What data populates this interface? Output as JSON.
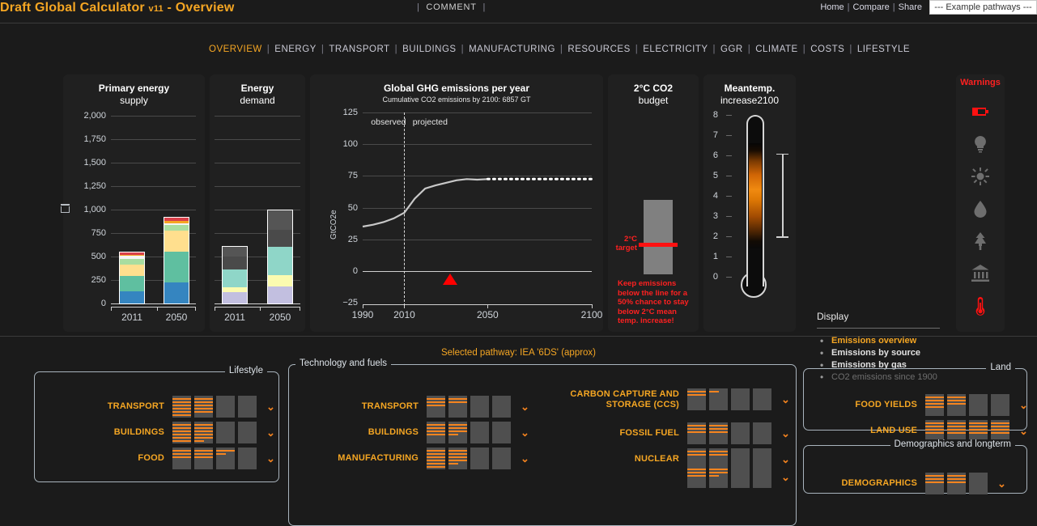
{
  "header": {
    "title": "Draft Global Calculator",
    "version": "v11",
    "title_suffix": "- Overview",
    "comment": "COMMENT",
    "sep": "|",
    "links": [
      {
        "label": "Home"
      },
      {
        "label": "Compare"
      },
      {
        "label": "Share"
      }
    ],
    "pathway_select": "--- Example pathways ---"
  },
  "nav": {
    "items": [
      {
        "label": "OVERVIEW",
        "active": true
      },
      {
        "label": "ENERGY",
        "active": false
      },
      {
        "label": "TRANSPORT",
        "active": false
      },
      {
        "label": "BUILDINGS",
        "active": false
      },
      {
        "label": "MANUFACTURING",
        "active": false
      },
      {
        "label": "RESOURCES",
        "active": false
      },
      {
        "label": "ELECTRICITY",
        "active": false
      },
      {
        "label": "GGR",
        "active": false
      },
      {
        "label": "CLIMATE",
        "active": false
      },
      {
        "label": "COSTS",
        "active": false
      },
      {
        "label": "LIFESTYLE",
        "active": false
      }
    ],
    "sep": "|"
  },
  "chart_data": [
    {
      "type": "bar",
      "id": "primary-energy-supply",
      "title": "Primary energy",
      "title2": "supply",
      "categories": [
        "2011",
        "2050"
      ],
      "ylim": [
        0,
        2000
      ],
      "yticks": [
        0,
        250,
        500,
        750,
        1000,
        1250,
        1500,
        1750,
        2000
      ],
      "ytick_labels": [
        "0",
        "250",
        "500",
        "750",
        "1,000",
        "1,250",
        "1,500",
        "1,750",
        "2,000"
      ],
      "unit_icon": "energy-unit-icon",
      "stacked": true,
      "series": [
        {
          "name": "blue",
          "color": "#3585c0",
          "values": [
            128,
            222
          ]
        },
        {
          "name": "green",
          "color": "#5fbfa0",
          "values": [
            168,
            327
          ]
        },
        {
          "name": "yellow",
          "color": "#ffdf8e",
          "values": [
            118,
            230
          ]
        },
        {
          "name": "lightgreen",
          "color": "#a9dda0",
          "values": [
            62,
            60
          ]
        },
        {
          "name": "white",
          "color": "#f4f4f4",
          "values": [
            32,
            12
          ]
        },
        {
          "name": "orange",
          "color": "#f5a623",
          "values": [
            10,
            26
          ]
        },
        {
          "name": "red",
          "color": "#d9404a",
          "values": [
            22,
            33
          ]
        }
      ],
      "totals": [
        540,
        910
      ]
    },
    {
      "type": "bar",
      "id": "energy-demand",
      "title": "Energy",
      "title2": "demand",
      "categories": [
        "2011",
        "2050"
      ],
      "ylim": [
        0,
        2000
      ],
      "stacked": true,
      "series": [
        {
          "name": "lavender",
          "color": "#c2bfe0",
          "values": [
            118,
            180
          ]
        },
        {
          "name": "paleyellow",
          "color": "#fbfbb0",
          "values": [
            57,
            118
          ]
        },
        {
          "name": "mint",
          "color": "#8fd6c8",
          "values": [
            183,
            305
          ]
        },
        {
          "name": "darkgray",
          "color": "#4a4a4a",
          "values": [
            145,
            185
          ]
        },
        {
          "name": "darkgray2",
          "color": "#555555",
          "values": [
            97,
            207
          ]
        }
      ],
      "totals": [
        600,
        995
      ]
    },
    {
      "type": "line",
      "id": "global-ghg-emissions",
      "title": "Global GHG emissions per year",
      "subtitle": "Cumulative CO2 emissions by 2100: 6857 GT",
      "ylabel": "GtCO2e",
      "xlim": [
        1990,
        2100
      ],
      "ylim": [
        -25,
        125
      ],
      "yticks": [
        -25,
        0,
        25,
        50,
        75,
        100,
        125
      ],
      "xticks": [
        1990,
        2010,
        2050,
        2100
      ],
      "divider_year": 2010,
      "region_labels": {
        "left": "observed",
        "right": "projected"
      },
      "line_color": "#c8c8c8",
      "marker_year": 2032,
      "marker_color": "#ff0000",
      "x": [
        1990,
        1995,
        2000,
        2005,
        2010,
        2015,
        2020,
        2025,
        2030,
        2035,
        2040,
        2045,
        2050,
        2060,
        2070,
        2080,
        2090,
        2100
      ],
      "y": [
        35,
        36.5,
        38.5,
        41.5,
        46,
        57,
        65,
        67.5,
        69.5,
        71.5,
        72.5,
        72,
        72.5,
        72.5,
        72.5,
        72.5,
        72.5,
        72.5
      ],
      "solid_until": 2050
    },
    {
      "type": "bar",
      "id": "co2-budget",
      "title": "2°C CO2",
      "title2": "budget",
      "target_label_line1": "2°C",
      "target_label_line2": "target",
      "note": "Keep emissions below the line for a 50% chance to stay below 2°C mean temp. increase!",
      "bar_color": "#808080",
      "line_color": "#ff1111",
      "bar_top_pct": 62,
      "target_pct": 53
    },
    {
      "type": "gauge",
      "id": "mean-temp-increase",
      "title": "Meantemp.",
      "title2": "increase2100",
      "ylim": [
        0,
        8
      ],
      "yticks": [
        0,
        1,
        2,
        3,
        4,
        5,
        6,
        7,
        8
      ],
      "fill_low": 1.4,
      "fill_high": 6.6,
      "range_low": 2.0,
      "range_high": 6.1
    }
  ],
  "display": {
    "title": "Display",
    "items": [
      {
        "label": "Emissions overview",
        "state": "selected"
      },
      {
        "label": "Emissions by source",
        "state": "normal"
      },
      {
        "label": "Emissions by gas",
        "state": "normal"
      },
      {
        "label": "CO2 emissions since 1900",
        "state": "disabled"
      }
    ]
  },
  "warnings": {
    "title": "Warnings",
    "icons": [
      {
        "name": "battery-icon",
        "color": "#ff1111"
      },
      {
        "name": "lightbulb-icon",
        "color": "#6e6e6e"
      },
      {
        "name": "sun-icon",
        "color": "#6e6e6e"
      },
      {
        "name": "droplet-icon",
        "color": "#6e6e6e"
      },
      {
        "name": "tree-icon",
        "color": "#6e6e6e"
      },
      {
        "name": "bank-icon",
        "color": "#6e6e6e"
      },
      {
        "name": "thermometer-icon",
        "color": "#ff1111"
      }
    ]
  },
  "selected_pathway": "Selected pathway: IEA '6DS' (approx)",
  "lever_groups": [
    {
      "legend": "Lifestyle",
      "rows": [
        {
          "label": "TRANSPORT",
          "boxes": [
            6,
            5,
            0,
            0
          ]
        },
        {
          "label": "BUILDINGS",
          "boxes": [
            6,
            5.5,
            0,
            0
          ]
        },
        {
          "label": "FOOD",
          "boxes": [
            3,
            3,
            1.5,
            0
          ]
        }
      ]
    },
    {
      "legend": "Technology and fuels",
      "rows": [
        {
          "label": "TRANSPORT",
          "boxes": [
            3,
            2,
            0,
            0
          ]
        },
        {
          "label": "BUILDINGS",
          "boxes": [
            4,
            3.5,
            0,
            0
          ]
        },
        {
          "label": "MANUFACTURING",
          "boxes": [
            6,
            4.5,
            0,
            0
          ]
        }
      ]
    },
    {
      "legend": "",
      "rows": [
        {
          "label": "CARBON CAPTURE AND STORAGE (CCS)",
          "boxes": [
            2,
            0.5,
            0,
            0
          ]
        },
        {
          "label": "FOSSIL FUEL",
          "boxes": [
            3,
            3,
            0,
            0
          ]
        },
        {
          "label": "NUCLEAR",
          "boxes": [
            2,
            2,
            0,
            0
          ]
        },
        {
          "label": "",
          "boxes": [
            3,
            2.5,
            0,
            0
          ]
        }
      ]
    },
    {
      "legend": "Land",
      "rows": [
        {
          "label": "FOOD YIELDS",
          "boxes": [
            4,
            3,
            0,
            0
          ]
        },
        {
          "label": "LAND USE",
          "boxes": [
            4,
            4,
            4,
            4
          ]
        }
      ]
    },
    {
      "legend": "Demographics and longterm",
      "rows": [
        {
          "label": "DEMOGRAPHICS",
          "boxes": [
            3,
            3,
            0
          ]
        }
      ]
    }
  ],
  "chevron": "⌄"
}
